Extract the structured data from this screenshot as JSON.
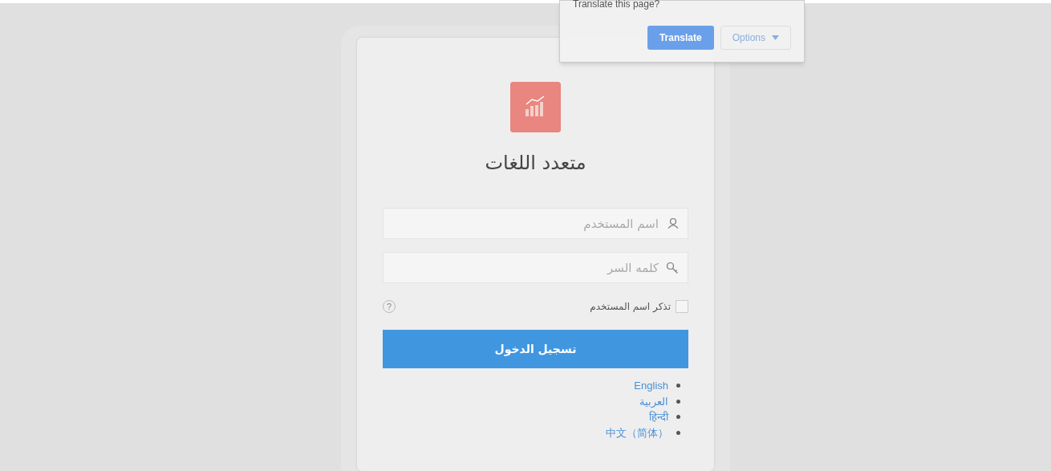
{
  "translate_popup": {
    "prompt": "Translate this page?",
    "translate_button": "Translate",
    "options_button": "Options"
  },
  "login": {
    "title": "متعدد اللغات",
    "fields": [
      {
        "placeholder": "اسم المستخدم",
        "kind": "user"
      },
      {
        "placeholder": "كلمه السر",
        "kind": "key"
      }
    ],
    "remember": {
      "label": "تذكر اسم المستخدم",
      "checked": false
    },
    "help": "?",
    "submit": "تسجيل الدخول",
    "languages": [
      "English",
      "العربية",
      "हिन्दी",
      "中文（简体）"
    ]
  }
}
